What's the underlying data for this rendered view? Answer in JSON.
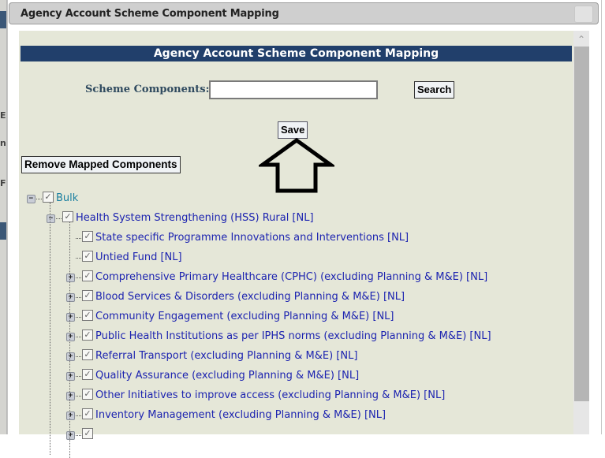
{
  "background": {
    "fragments": [
      "E",
      "n",
      "F"
    ]
  },
  "dialog": {
    "title": "Agency Account Scheme Component Mapping",
    "close_icon": "close-icon"
  },
  "panel": {
    "header": "Agency Account Scheme Component Mapping",
    "search": {
      "label": "Scheme Components:",
      "value": "",
      "placeholder": "",
      "button": "Search"
    },
    "save_button": "Save",
    "remove_button": "Remove Mapped Components",
    "annotation": "arrow-up-pointing-to-save"
  },
  "tree": {
    "root": {
      "label": "Bulk",
      "checked": true,
      "expanded": true,
      "children": [
        {
          "label": "Health System Strengthening (HSS) Rural [NL]",
          "checked": true,
          "expanded": true,
          "children": [
            {
              "label": "State specific Programme Innovations and Interventions [NL]",
              "checked": true,
              "expandable": false
            },
            {
              "label": "Untied Fund [NL]",
              "checked": true,
              "expandable": false
            },
            {
              "label": "Comprehensive Primary Healthcare (CPHC) (excluding Planning & M&E) [NL]",
              "checked": true,
              "expandable": true
            },
            {
              "label": "Blood Services & Disorders (excluding Planning & M&E) [NL]",
              "checked": true,
              "expandable": true
            },
            {
              "label": "Community Engagement (excluding Planning & M&E) [NL]",
              "checked": true,
              "expandable": true
            },
            {
              "label": "Public Health Institutions as per IPHS norms (excluding Planning & M&E) [NL]",
              "checked": true,
              "expandable": true
            },
            {
              "label": "Referral Transport (excluding Planning & M&E) [NL]",
              "checked": true,
              "expandable": true
            },
            {
              "label": "Quality Assurance (excluding Planning & M&E) [NL]",
              "checked": true,
              "expandable": true
            },
            {
              "label": "Other Initiatives to improve access (excluding Planning & M&E) [NL]",
              "checked": true,
              "expandable": true
            },
            {
              "label": "Inventory Management (excluding Planning & M&E) [NL]",
              "checked": true,
              "expandable": true
            },
            {
              "label": "",
              "checked": true,
              "expandable": true
            }
          ]
        }
      ]
    }
  }
}
